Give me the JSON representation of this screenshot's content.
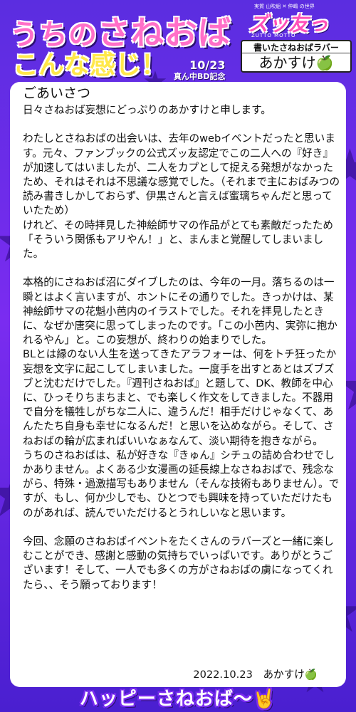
{
  "header": {
    "title_line1_a": "うちの",
    "title_line1_b": "さねおば",
    "title_line2": "こんな感じ！",
    "date": "10/23",
    "date_sub": "真ん中BD記念",
    "logo_pre": "実質 山吹組 ✕ 仲嶋 の世界",
    "logo_main": "ズッ友っと！",
    "logo_sub": "ZUTTO MOTTO",
    "author_label": "書いたさねおばラバー",
    "author_name": "あかすけ🍏"
  },
  "content": {
    "heading": "ごあいさつ",
    "paragraphs": [
      "日々さねおば妄想にどっぷりのあかすけと申します。",
      "",
      "わたしとさねおばの出会いは、去年のwebイベントだったと思います。元々、ファンブックの公式ズッ友認定でこの二人への『好き』が加速してはいましたが、二人をカプとして捉える発想がなかったため、それはそれは不思議な感覚でした。（それまで主におばみつの読み書きしかしておらず、伊黒さんと言えば蜜璃ちゃんだと思っていたため）",
      "けれど、その時拝見した神絵師サマの作品がとても素敵だったため「そういう関係もアリやん！」と、まんまと覚醒してしまいました。",
      "",
      "本格的にさねおば沼にダイブしたのは、今年の一月。落ちるのは一瞬とはよく言いますが、ホントにその通りでした。きっかけは、某神絵師サマの花魁小芭内のイラストでした。それを拝見したときに、なぜか唐突に思ってしまったのです。「この小芭内、実弥に抱かれるやん」と。この妄想が、終わりの始まりでした。",
      "BLとは縁のない人生を送ってきたアラフォーは、何をトチ狂ったか妄想を文字に起こしてしまいました。一度手を出すとあとはズブズブと沈むだけでした。『週刊さねおば』と題して、DK、教師を中心に、ひっそりちまちまと、でも楽しく作文をしてきました。不器用で自分を犠牲しがちな二人に、違うんだ！相手だけじゃなくて、あんたたち自身も幸せになるんだ！と思いを込めながら。そして、さねおばの輪が広まればいいなぁなんて、淡い期待を抱きながら。",
      "うちのさねおばは、私が好きな『きゅん』シチュの詰め合わせでしかありません。よくある少女漫画の延長線上なさねおばで、残念ながら、特殊・過激描写もありません（そんな技術もありません）。ですが、もし、何か少しでも、ひとつでも興味を持っていただけたものがあれば、読んでいただけるとうれしいなと思います。",
      "",
      "今回、念願のさねおばイベントをたくさんのラバーズと一緒に楽しむことができ、感謝と感動の気持ちでいっぱいです。ありがとうございます！そして、一人でも多くの方がさねおばの虜になってくれたら、、そう願っております！"
    ],
    "signature": "2022.10.23　あかすけ🍏"
  },
  "footer": {
    "text": "ハッピーさねおば〜🤘"
  },
  "colors": {
    "background_top": "#5b2de0",
    "background_bottom": "#4a1fd0",
    "title_pink": "#ff6fc8",
    "title_yellow": "#ffe84a",
    "card": "#ffffff"
  }
}
